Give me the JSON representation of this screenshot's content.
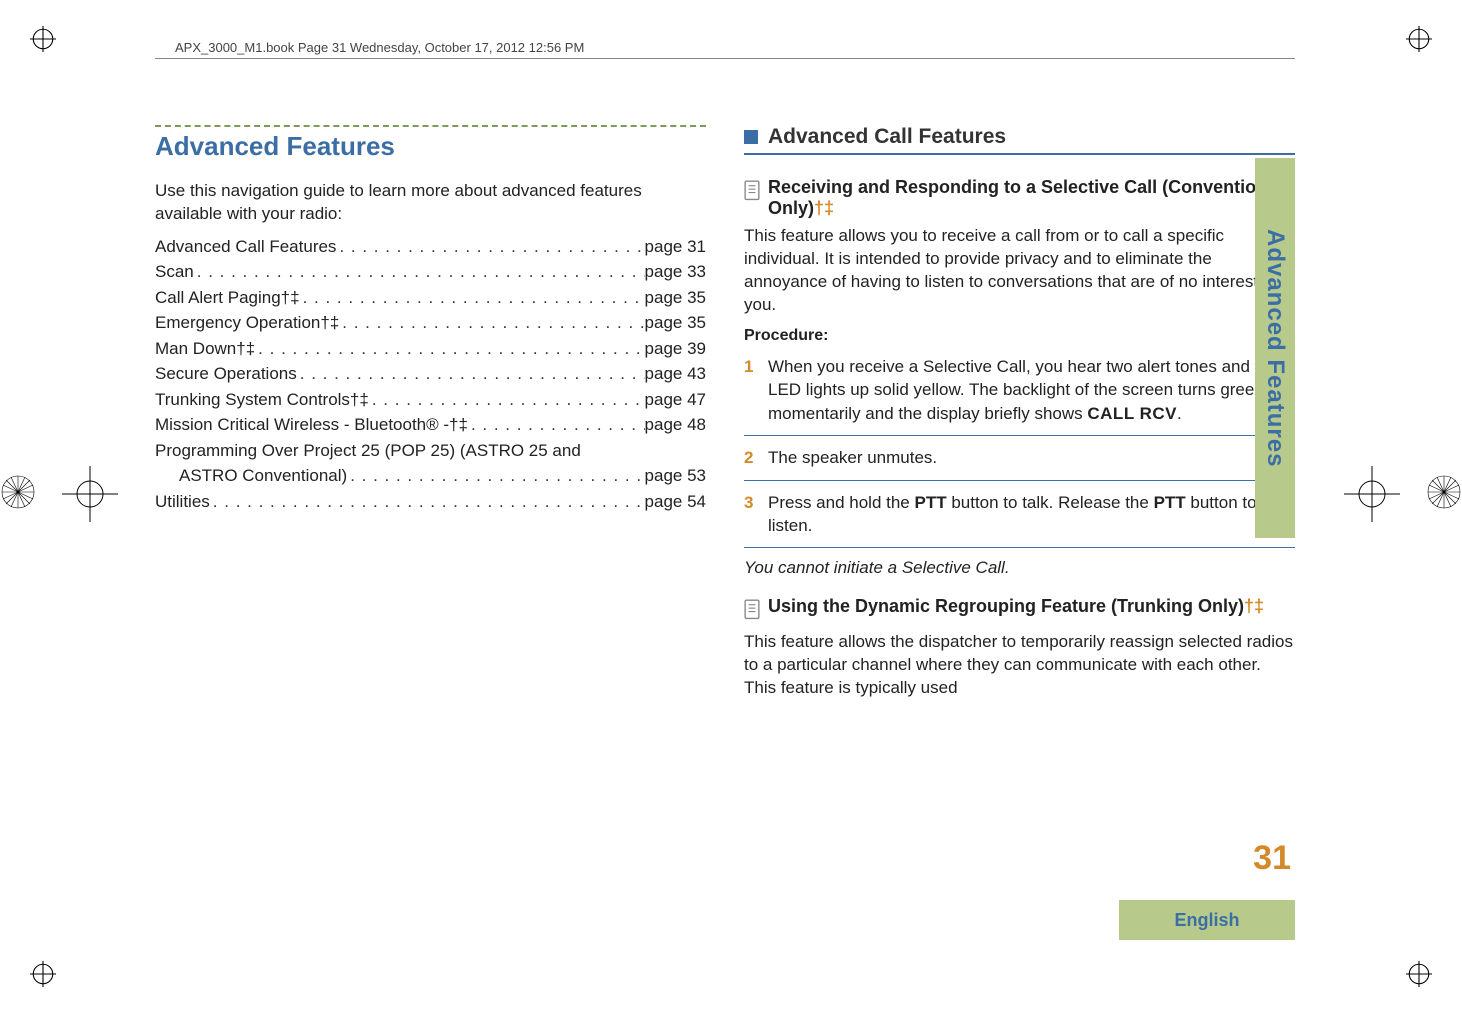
{
  "running_header": "APX_3000_M1.book  Page 31  Wednesday, October 17, 2012  12:56 PM",
  "title": "Advanced Features",
  "intro": "Use this navigation guide to learn more about advanced features available with your radio:",
  "toc": [
    {
      "label": "Advanced Call Features",
      "page": "page 31"
    },
    {
      "label": "Scan",
      "page": "page 33"
    },
    {
      "label": "Call Alert Paging†‡",
      "page": "page 35"
    },
    {
      "label": "Emergency Operation†‡",
      "page": "page 35"
    },
    {
      "label": "Man Down†‡",
      "page": "page 39"
    },
    {
      "label": "Secure Operations",
      "page": "page 43"
    },
    {
      "label": "Trunking System Controls†‡",
      "page": "page 47"
    },
    {
      "label": "Mission Critical Wireless - Bluetooth® -†‡",
      "page": "page 48"
    },
    {
      "label": "Programming Over Project 25 (POP 25) (ASTRO 25 and",
      "page": ""
    },
    {
      "label": "ASTRO Conventional)",
      "page": "page 53",
      "indent": true
    },
    {
      "label": "Utilities",
      "page": "page 54"
    }
  ],
  "section_head": "Advanced Call Features",
  "sub1": {
    "title_a": "Receiving and Responding to a Selective Call (Conventional Only)",
    "title_marker": "†‡",
    "body": "This feature allows you to receive a call from or to call a specific individual. It is intended to provide privacy and to eliminate the annoyance of having to listen to conversations that are of no interest to you.",
    "proc_label": "Procedure:",
    "steps": [
      {
        "num": "1",
        "text_a": "When you receive a Selective Call, you hear two alert tones and the LED lights up solid yellow. The backlight of the screen turns green momentarily and the display briefly shows ",
        "mono": "CALL RCV",
        "text_b": "."
      },
      {
        "num": "2",
        "text_a": "The speaker unmutes."
      },
      {
        "num": "3",
        "text_a": "Press and hold the ",
        "bold1": "PTT",
        "text_b": " button to talk. Release the ",
        "bold2": "PTT",
        "text_c": " button to listen."
      }
    ],
    "note": "You cannot initiate a Selective Call."
  },
  "sub2": {
    "title_a": "Using the Dynamic Regrouping Feature (Trunking Only)",
    "title_marker": "†‡",
    "body": "This feature allows the dispatcher to temporarily reassign selected radios to a particular channel where they can communicate with each other. This feature is typically used"
  },
  "side_tab": "Advanced Features",
  "page_number": "31",
  "footer_lang": "English"
}
